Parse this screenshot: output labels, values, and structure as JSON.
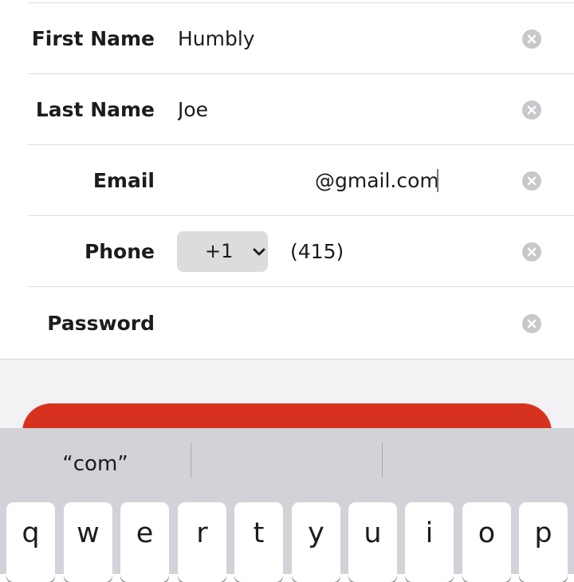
{
  "form": {
    "first_name": {
      "label": "First Name",
      "value": "Humbly"
    },
    "last_name": {
      "label": "Last Name",
      "value": "Joe"
    },
    "email": {
      "label": "Email",
      "value": "@gmail.com"
    },
    "phone": {
      "label": "Phone",
      "country_code": "+1",
      "value": "(415) 8"
    },
    "password": {
      "label": "Password",
      "value": ""
    }
  },
  "keyboard": {
    "suggestions": [
      "“com”",
      "",
      ""
    ],
    "keys": [
      "q",
      "w",
      "e",
      "r",
      "t",
      "y",
      "u",
      "i",
      "o",
      "p"
    ]
  },
  "colors": {
    "accent": "#d7321f",
    "keyboard_bg": "#d2d3d9",
    "clear_icon": "#c7c7cc"
  },
  "icons": {
    "clear": "clear-icon",
    "dropdown": "chevron-down-icon"
  }
}
